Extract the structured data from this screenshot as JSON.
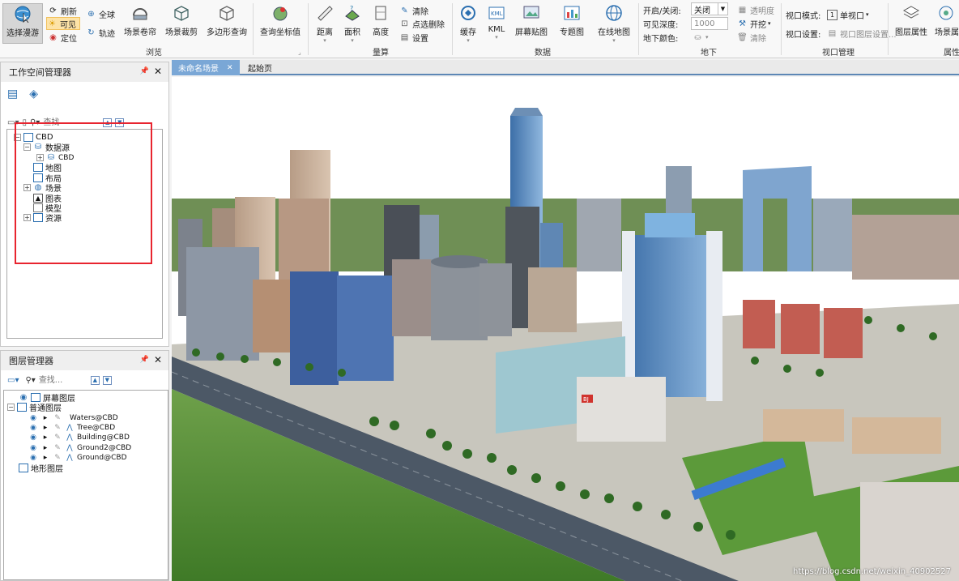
{
  "ribbon": {
    "browse": {
      "select_pan": "选择漫游",
      "refresh": "刷新",
      "visible": "可见",
      "locate": "定位",
      "globe": "全球",
      "track": "轨迹",
      "scene_curtain": "场景卷帘",
      "scene_clip": "场景裁剪",
      "polygon_query": "多边形查询",
      "query_coords": "查询坐标值",
      "group": "浏览"
    },
    "measure": {
      "distance": "距离",
      "area": "面积",
      "height": "高度",
      "clear": "清除",
      "pick_delete": "点选删除",
      "settings": "设置",
      "group": "量算"
    },
    "data": {
      "cache": "缓存",
      "kml": "KML",
      "screen_paste": "屏幕贴图",
      "thematic": "专题图",
      "online_map": "在线地图",
      "group": "数据"
    },
    "underground": {
      "onoff_label": "开启/关闭:",
      "onoff_value": "关闭",
      "visible_depth_label": "可见深度:",
      "visible_depth_value": "1000",
      "underground_color": "地下颜色:",
      "transparency": "透明度",
      "excavate": "开挖",
      "clear": "清除",
      "group": "地下"
    },
    "viewport": {
      "mode_label": "视口模式:",
      "mode_value": "单视口",
      "settings_label": "视口设置:",
      "settings_value": "视口图层设置...",
      "group": "视口管理"
    },
    "layer": {
      "layer_props": "图层属性",
      "scene_props": "场景属",
      "group": "属性"
    }
  },
  "workspace": {
    "title": "工作空间管理器",
    "search_placeholder": "查找",
    "tree": [
      {
        "label": "CBD"
      },
      {
        "label": "数据源"
      },
      {
        "label": "CBD"
      },
      {
        "label": "地图"
      },
      {
        "label": "布局"
      },
      {
        "label": "场景"
      },
      {
        "label": "图表"
      },
      {
        "label": "模型"
      },
      {
        "label": "资源"
      }
    ]
  },
  "layers": {
    "title": "图层管理器",
    "search_placeholder": "查找...",
    "tree": [
      {
        "label": "屏幕图层"
      },
      {
        "label": "普通图层"
      },
      {
        "label": "Waters@CBD"
      },
      {
        "label": "Tree@CBD"
      },
      {
        "label": "Building@CBD"
      },
      {
        "label": "Ground2@CBD"
      },
      {
        "label": "Ground@CBD"
      },
      {
        "label": "地形图层"
      }
    ]
  },
  "tabs": [
    {
      "label": "未命名场景",
      "active": true
    },
    {
      "label": "起始页",
      "active": false
    }
  ],
  "scene": {
    "billboard": "BJ",
    "watermark": "https://blog.csdn.net/weixin_40902527"
  },
  "colors": {
    "accent": "#5d87b5",
    "highlight_box": "#e8242f",
    "sky": "#ffffff",
    "grass": "#4e8a2c",
    "road": "#4c5866"
  }
}
